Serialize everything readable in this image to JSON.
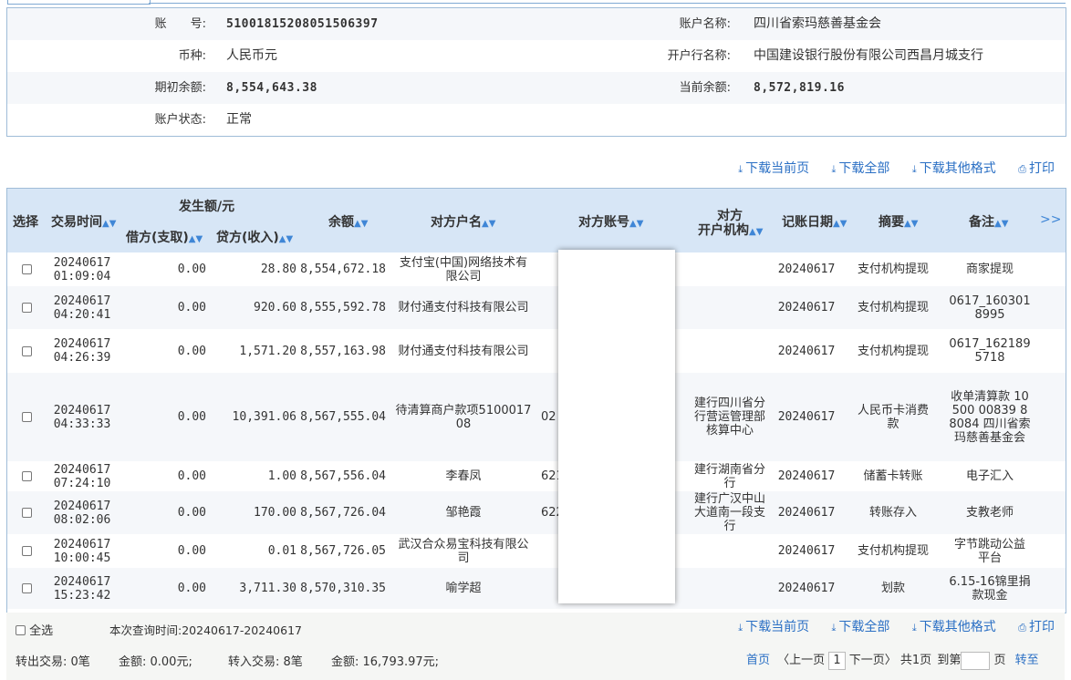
{
  "account": {
    "acct_no_label": "账　　号:",
    "acct_no": "510018152080515063​97",
    "acct_name_label": "账户名称:",
    "acct_name": "四川省索玛慈善基金会",
    "currency_label": "币种:",
    "currency": "人民币元",
    "bank_label": "开户行名称:",
    "bank": "中国建设银行股份有限公司西昌月城支行",
    "open_balance_label": "期初余额:",
    "open_balance": "8,554,643.38",
    "cur_balance_label": "当前余额:",
    "cur_balance": "8,572,819.16",
    "status_label": "账户状态:",
    "status": "正常"
  },
  "toolbar": {
    "download_page": "下载当前页",
    "download_all": "下载全部",
    "download_other": "下载其他格式",
    "print": "打印"
  },
  "grid": {
    "headers": {
      "select": "选择",
      "time": "交易时间",
      "amount_group": "发生额/元",
      "debit": "借方(支取)",
      "credit": "贷方(收入)",
      "balance": "余额",
      "cp_name": "对方户名",
      "cp_acct": "对方账号",
      "cp_bank_1": "对方",
      "cp_bank_2": "开户机构",
      "post_date": "记账日期",
      "summary": "摘要",
      "remark": "备注",
      "more": ">>"
    },
    "rows": [
      {
        "date": "20240617",
        "time": "01:09:04",
        "debit": "0.00",
        "credit": "28.80",
        "balance": "8,554,672.18",
        "cp_name": "支付宝(中国)网络技术有限公司",
        "cp_acct": "",
        "cp_bank": "",
        "post_date": "20240617",
        "summary": "支付机构提现",
        "remark": "商家提现"
      },
      {
        "date": "20240617",
        "time": "04:20:41",
        "debit": "0.00",
        "credit": "920.60",
        "balance": "8,555,592.78",
        "cp_name": "财付通支付科技有限公司",
        "cp_acct": "",
        "cp_bank": "",
        "post_date": "20240617",
        "summary": "支付机构提现",
        "remark": "0617_1603018995"
      },
      {
        "date": "20240617",
        "time": "04:26:39",
        "debit": "0.00",
        "credit": "1,571.20",
        "balance": "8,557,163.98",
        "cp_name": "财付通支付科技有限公司",
        "cp_acct": "",
        "cp_bank": "",
        "post_date": "20240617",
        "summary": "支付机构提现",
        "remark": "0617_1621895718"
      },
      {
        "date": "20240617",
        "time": "04:33:33",
        "debit": "0.00",
        "credit": "10,391.06",
        "balance": "8,567,555.04",
        "cp_name": "待清算商户款项510001708",
        "cp_acct": "02",
        "cp_bank": "建行四川省分行营运管理部核算中心",
        "post_date": "20240617",
        "summary": "人民币卡消费款",
        "remark": "收单清算款 10500 00839 88084 四川省索玛慈善基金会"
      },
      {
        "date": "20240617",
        "time": "07:24:10",
        "debit": "0.00",
        "credit": "1.00",
        "balance": "8,567,556.04",
        "cp_name": "李春凤",
        "cp_acct": "621",
        "cp_bank": "建行湖南省分行",
        "post_date": "20240617",
        "summary": "储蓄卡转账",
        "remark": "电子汇入"
      },
      {
        "date": "20240617",
        "time": "08:02:06",
        "debit": "0.00",
        "credit": "170.00",
        "balance": "8,567,726.04",
        "cp_name": "邹艳霞",
        "cp_acct": "622",
        "cp_bank": "建行广汉中山大道南一段支行",
        "post_date": "20240617",
        "summary": "转账存入",
        "remark": "支教老师"
      },
      {
        "date": "20240617",
        "time": "10:00:45",
        "debit": "0.00",
        "credit": "0.01",
        "balance": "8,567,726.05",
        "cp_name": "武汉合众易宝科技有限公司",
        "cp_acct": "",
        "cp_bank": "",
        "post_date": "20240617",
        "summary": "支付机构提现",
        "remark": "字节跳动公益平台"
      },
      {
        "date": "20240617",
        "time": "15:23:42",
        "debit": "0.00",
        "credit": "3,711.30",
        "balance": "8,570,310.35",
        "cp_name": "喻学超",
        "cp_acct": "",
        "cp_bank": "",
        "post_date": "20240617",
        "summary": "划款",
        "remark": "6.15-16锦里捐款现金"
      }
    ]
  },
  "footer": {
    "select_all": "全选",
    "query_time": "本次查询时间:20240617-20240617",
    "out_count": "转出交易: 0笔",
    "out_amount": "金额: 0.00元;",
    "in_count": "转入交易: 8笔",
    "in_amount": "金额: 16,793.97元;",
    "first": "首页",
    "prev": "〈上一页",
    "page": "1",
    "next": "下一页〉",
    "total": "共1页",
    "goto": "到第",
    "page_unit": "页",
    "go": "转至"
  }
}
